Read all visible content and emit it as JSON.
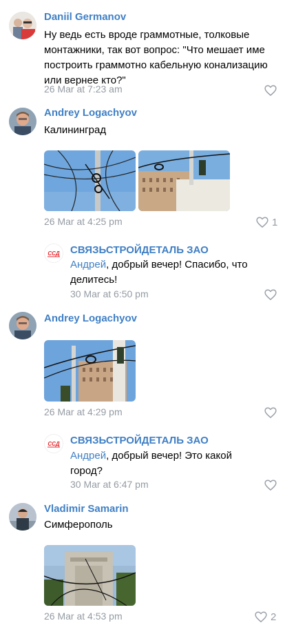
{
  "comments": [
    {
      "author": "Daniil Germanov",
      "text": "Ну ведь есть вроде граммотные, толковые монтажники, так вот вопрос: \"Что мешает име построить граммотно кабельную конализацию или вернее кто?\"",
      "time": "26 Mar at 7:23 am",
      "likes": ""
    },
    {
      "author": "Andrey Logachyov",
      "text": "Калининград",
      "time": "26 Mar at 4:25 pm",
      "likes": "1"
    },
    {
      "author": "СВЯЗЬСТРОЙДЕТАЛЬ ЗАО",
      "mention": "Андрей",
      "text": ", добрый вечер! Спасибо, что делитесь!",
      "time": "30 Mar at 6:50 pm",
      "likes": ""
    },
    {
      "author": "Andrey Logachyov",
      "text": "",
      "time": "26 Mar at 4:29 pm",
      "likes": ""
    },
    {
      "author": "СВЯЗЬСТРОЙДЕТАЛЬ ЗАО",
      "mention": "Андрей",
      "text": ", добрый вечер! Это какой город?",
      "time": "30 Mar at 6:47 pm",
      "likes": ""
    },
    {
      "author": "Vladimir Samarin",
      "text": "Симферополь",
      "time": "26 Mar at 4:53 pm",
      "likes": "2"
    }
  ],
  "company_logo_text": "ССД",
  "colors": {
    "author": "#3f7fc5",
    "meta": "#949ba3",
    "logo_red": "#e3262b"
  },
  "icons": [
    "heart-outline-icon"
  ]
}
